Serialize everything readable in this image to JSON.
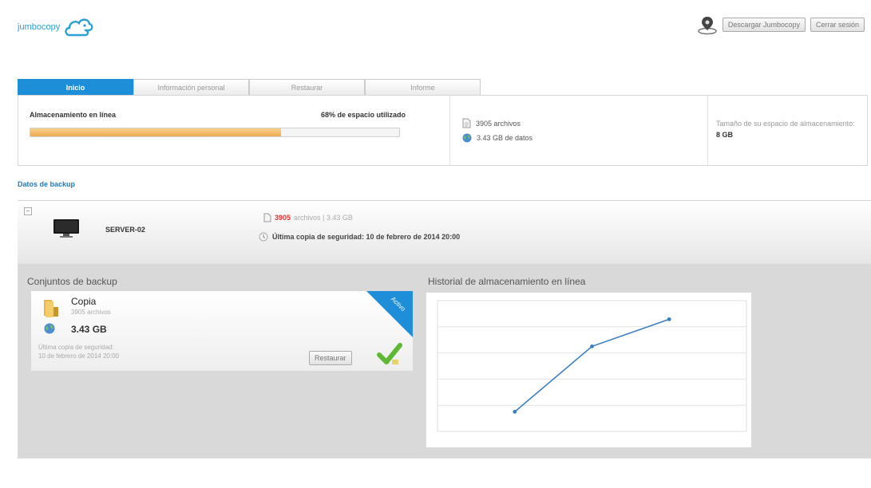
{
  "brand": {
    "name": "jumbocopy"
  },
  "top_actions": {
    "download_label": "Descargar Jumbocopy",
    "logout_label": "Cerrar sesión"
  },
  "tabs": [
    {
      "label": "Inicio",
      "active": true
    },
    {
      "label": "Información personal",
      "active": false
    },
    {
      "label": "Restaurar",
      "active": false
    },
    {
      "label": "Informe",
      "active": false
    }
  ],
  "storage": {
    "label": "Almacenamiento en línea",
    "percent_text": "68% de espacio utilizado",
    "usage_fraction": 0.68
  },
  "stats": {
    "files": "3905 archivos",
    "data": "3.43 GB  de datos"
  },
  "quota": {
    "text": "Tamaño de su espacio de almacenamiento:",
    "value": "8 GB"
  },
  "backup_section": {
    "title": "Datos de backup"
  },
  "server": {
    "collapse_symbol": "–",
    "name": "SERVER-02",
    "files_count": "3905",
    "files_suffix": "archivos | 3.43 GB",
    "last_backup": "Última copia de seguridad: 10 de febrero de 2014 20:00"
  },
  "sets": {
    "title": "Conjuntos de backup",
    "card": {
      "name": "Copia",
      "files": "3905 archivos",
      "size": "3.43 GB",
      "last_label": "Última copia de seguridad:",
      "last_date": "10 de febrero de 2014 20:00",
      "restore_label": "Restaurar",
      "ribbon_text": "Activo"
    }
  },
  "history": {
    "title": "Historial de almacenamiento en línea"
  },
  "chart_data": {
    "type": "line",
    "title": "Historial de almacenamiento en línea",
    "x": [
      1,
      2,
      3
    ],
    "series": [
      {
        "values": [
          0.6,
          2.6,
          3.43
        ]
      }
    ],
    "xlim": [
      0,
      4
    ],
    "ylim": [
      0,
      4
    ],
    "grid": true,
    "color": "#3a7fc1"
  },
  "colors": {
    "accent": "#1d8fd8",
    "progress": "#eeaa50",
    "check": "#5fb832",
    "danger": "#e53030"
  }
}
